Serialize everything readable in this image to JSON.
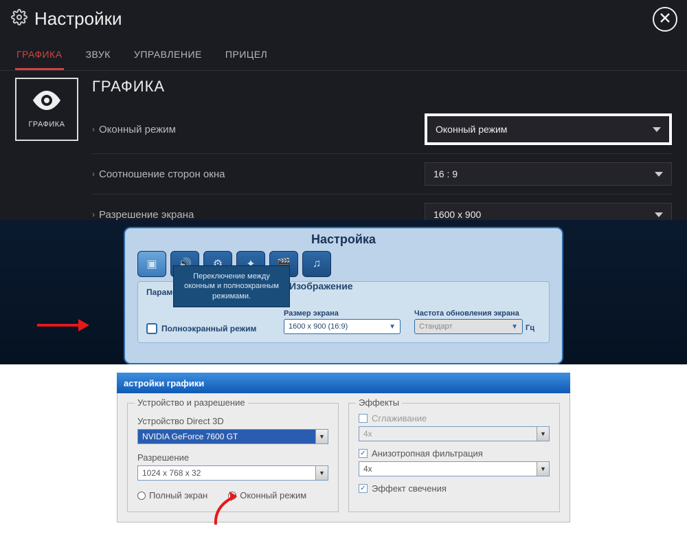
{
  "panel1": {
    "title": "Настройки",
    "tabs": [
      "ГРАФИКА",
      "ЗВУК",
      "УПРАВЛЕНИЕ",
      "ПРИЦЕЛ"
    ],
    "card_label": "ГРАФИКА",
    "section_title": "ГРАФИКА",
    "rows": [
      {
        "label": "Оконный режим",
        "value": "Оконный режим"
      },
      {
        "label": "Соотношение сторон окна",
        "value": "16 : 9"
      },
      {
        "label": "Разрешение экрана",
        "value": "1600 x 900"
      }
    ]
  },
  "panel2": {
    "title": "Настройка",
    "tooltip": "Переключение между оконным и полноэкранным режимами.",
    "content_title": "Изображение",
    "sub_title": "Параметры",
    "fullscreen_label": "Полноэкранный режим",
    "screen_size_label": "Размер экрана",
    "screen_size_value": "1600 x 900 (16:9)",
    "refresh_label": "Частота обновления экрана",
    "refresh_value": "Стандарт",
    "hz": "Гц"
  },
  "panel3": {
    "title": "астройки графики",
    "group1_title": "Устройство и разрешение",
    "device_label": "Устройство Direct 3D",
    "device_value": "NVIDIA GeForce 7600 GT",
    "res_label": "Разрешение",
    "res_value": "1024 x 768 x 32",
    "radio_full": "Полный экран",
    "radio_window": "Оконный режим",
    "group2_title": "Эффекты",
    "aa_label": "Сглаживание",
    "aa_value": "4x",
    "aniso_label": "Анизотропная фильтрация",
    "aniso_value": "4x",
    "glow_label": "Эффект свечения"
  }
}
